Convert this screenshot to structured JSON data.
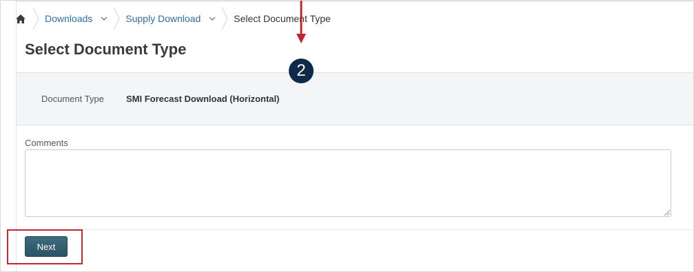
{
  "breadcrumb": {
    "home_icon": "home-icon",
    "items": [
      {
        "label": "Downloads"
      },
      {
        "label": "Supply Download"
      }
    ],
    "current": "Select Document Type"
  },
  "page": {
    "title": "Select Document Type"
  },
  "annotation": {
    "step_number": "2",
    "color": "#c1272d",
    "badge_color": "#0d2a4a"
  },
  "document": {
    "type_label": "Document Type",
    "type_value": "SMI Forecast Download (Horizontal)"
  },
  "comments": {
    "label": "Comments",
    "value": ""
  },
  "actions": {
    "next_label": "Next"
  },
  "colors": {
    "link": "#2e6da4",
    "button": "#2f5a6c",
    "panel_bg": "#f3f5f6"
  }
}
